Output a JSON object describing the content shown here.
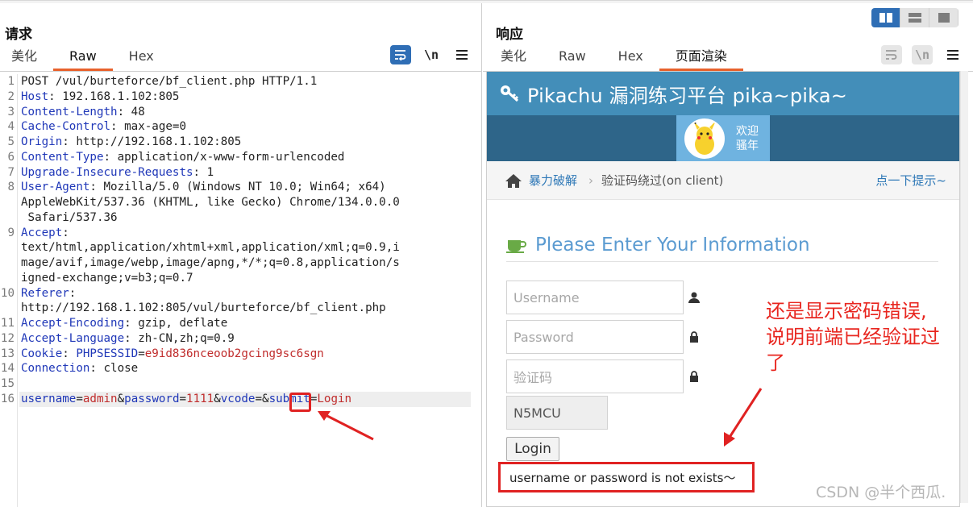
{
  "request": {
    "title": "请求",
    "tabs": [
      "美化",
      "Raw",
      "Hex"
    ],
    "active_tab": "Raw",
    "toolbar": {
      "wrap_icon": "wrap-lines-icon",
      "newline_label": "\\n",
      "menu_icon": "hamburger-menu-icon"
    },
    "lines": [
      {
        "n": "1",
        "parts": [
          {
            "t": "POST /vul/burteforce/bf_client.php HTTP/1.1",
            "c": ""
          }
        ]
      },
      {
        "n": "2",
        "parts": [
          {
            "t": "Host",
            "c": "k"
          },
          {
            "t": ": 192.168.1.102:805",
            "c": ""
          }
        ]
      },
      {
        "n": "3",
        "parts": [
          {
            "t": "Content-Length",
            "c": "k"
          },
          {
            "t": ": 48",
            "c": ""
          }
        ]
      },
      {
        "n": "4",
        "parts": [
          {
            "t": "Cache-Control",
            "c": "k"
          },
          {
            "t": ": max-age=0",
            "c": ""
          }
        ]
      },
      {
        "n": "5",
        "parts": [
          {
            "t": "Origin",
            "c": "k"
          },
          {
            "t": ": http://192.168.1.102:805",
            "c": ""
          }
        ]
      },
      {
        "n": "6",
        "parts": [
          {
            "t": "Content-Type",
            "c": "k"
          },
          {
            "t": ": application/x-www-form-urlencoded",
            "c": ""
          }
        ]
      },
      {
        "n": "7",
        "parts": [
          {
            "t": "Upgrade-Insecure-Requests",
            "c": "k"
          },
          {
            "t": ": 1",
            "c": ""
          }
        ]
      },
      {
        "n": "8",
        "parts": [
          {
            "t": "User-Agent",
            "c": "k"
          },
          {
            "t": ": Mozilla/5.0 (Windows NT 10.0; Win64; x64)",
            "c": ""
          }
        ]
      },
      {
        "n": "",
        "parts": [
          {
            "t": "AppleWebKit/537.36 (KHTML, like Gecko) Chrome/134.0.0.0",
            "c": ""
          }
        ]
      },
      {
        "n": "",
        "parts": [
          {
            "t": " Safari/537.36",
            "c": ""
          }
        ]
      },
      {
        "n": "9",
        "parts": [
          {
            "t": "Accept",
            "c": "k"
          },
          {
            "t": ":",
            "c": ""
          }
        ]
      },
      {
        "n": "",
        "parts": [
          {
            "t": "text/html,application/xhtml+xml,application/xml;q=0.9,i",
            "c": ""
          }
        ]
      },
      {
        "n": "",
        "parts": [
          {
            "t": "mage/avif,image/webp,image/apng,*/*;q=0.8,application/s",
            "c": ""
          }
        ]
      },
      {
        "n": "",
        "parts": [
          {
            "t": "igned-exchange;v=b3;q=0.7",
            "c": ""
          }
        ]
      },
      {
        "n": "10",
        "parts": [
          {
            "t": "Referer",
            "c": "k"
          },
          {
            "t": ":",
            "c": ""
          }
        ]
      },
      {
        "n": "",
        "parts": [
          {
            "t": "http://192.168.1.102:805/vul/burteforce/bf_client.php",
            "c": ""
          }
        ]
      },
      {
        "n": "11",
        "parts": [
          {
            "t": "Accept-Encoding",
            "c": "k"
          },
          {
            "t": ": gzip, deflate",
            "c": ""
          }
        ]
      },
      {
        "n": "12",
        "parts": [
          {
            "t": "Accept-Language",
            "c": "k"
          },
          {
            "t": ": zh-CN,zh;q=0.9",
            "c": ""
          }
        ]
      },
      {
        "n": "13",
        "parts": [
          {
            "t": "Cookie",
            "c": "k"
          },
          {
            "t": ": ",
            "c": ""
          },
          {
            "t": "PHPSESSID",
            "c": "k"
          },
          {
            "t": "=",
            "c": ""
          },
          {
            "t": "e9id836nceoob2gcing9sc6sgn",
            "c": "rv"
          }
        ]
      },
      {
        "n": "14",
        "parts": [
          {
            "t": "Connection",
            "c": "k"
          },
          {
            "t": ": close",
            "c": ""
          }
        ]
      },
      {
        "n": "15",
        "parts": [
          {
            "t": "",
            "c": ""
          }
        ]
      },
      {
        "n": "16",
        "hl": true,
        "parts": [
          {
            "t": "username",
            "c": "k"
          },
          {
            "t": "=",
            "c": ""
          },
          {
            "t": "admin",
            "c": "rv"
          },
          {
            "t": "&",
            "c": ""
          },
          {
            "t": "password",
            "c": "k"
          },
          {
            "t": "=",
            "c": ""
          },
          {
            "t": "1111",
            "c": "rv"
          },
          {
            "t": "&",
            "c": ""
          },
          {
            "t": "vcode",
            "c": "k"
          },
          {
            "t": "=&",
            "c": ""
          },
          {
            "t": "submit",
            "c": "k"
          },
          {
            "t": "=",
            "c": ""
          },
          {
            "t": "Login",
            "c": "rv"
          }
        ]
      }
    ]
  },
  "response": {
    "title": "响应",
    "tabs": [
      "美化",
      "Raw",
      "Hex",
      "页面渲染"
    ],
    "active_tab": "页面渲染",
    "layout_buttons": [
      "split-view-icon",
      "horizontal-view-icon",
      "single-view-icon"
    ]
  },
  "page": {
    "brand": "Pikachu 漏洞练习平台 pika~pika~",
    "welcome_line1": "欢迎",
    "welcome_line2": "骚年",
    "breadcrumb_parent": "暴力破解",
    "breadcrumb_sep": "›",
    "breadcrumb_current": "验证码绕过(on client)",
    "hint_link": "点一下提示~",
    "form_title": "Please Enter Your Information",
    "username_placeholder": "Username",
    "password_placeholder": "Password",
    "captcha_placeholder": "验证码",
    "captcha_code": "N5MCU",
    "login_button": "Login",
    "error_message": "username or password is not exists～"
  },
  "annotation": {
    "line1": "还是显示密码错误,",
    "line2": "说明前端已经验证过",
    "line3": "了"
  },
  "watermark": "CSDN @半个西瓜.",
  "colors": {
    "accent": "#e8612c",
    "navbar": "#438eb9",
    "annotation_red": "#e8261f",
    "key_blue": "#1f37b8",
    "value_red": "#c02c2c"
  }
}
